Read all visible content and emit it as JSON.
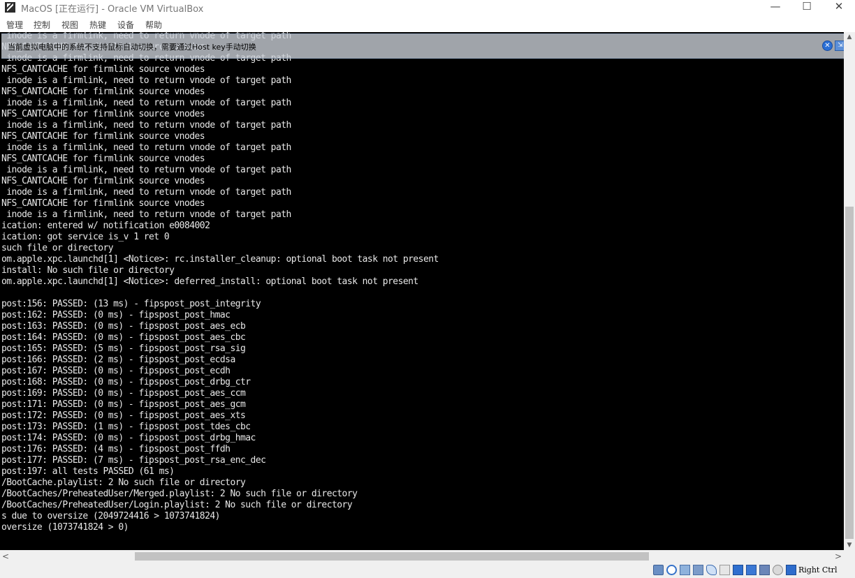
{
  "window": {
    "title": "MacOS [正在运行] - Oracle VM VirtualBox",
    "minimize_glyph": "—",
    "maximize_glyph": "☐",
    "close_glyph": "✕"
  },
  "menu": [
    "管理",
    "控制",
    "视图",
    "热键",
    "设备",
    "帮助"
  ],
  "notice": {
    "text": "当前虚拟电脑中的系统不支持鼠标自动切换，需要通过Host key手动切换",
    "close_glyph": "✕",
    "tool_glyph": "⇲"
  },
  "console": {
    "lines": [
      " inode is a firmlink, need to return vnode of target path",
      "NFS_CANTCACHE for firmlink source vnodes",
      " inode is a firmlink, need to return vnode of target path",
      "NFS_CANTCACHE for firmlink source vnodes",
      " inode is a firmlink, need to return vnode of target path",
      "NFS_CANTCACHE for firmlink source vnodes",
      " inode is a firmlink, need to return vnode of target path",
      "NFS_CANTCACHE for firmlink source vnodes",
      " inode is a firmlink, need to return vnode of target path",
      "NFS_CANTCACHE for firmlink source vnodes",
      " inode is a firmlink, need to return vnode of target path",
      "NFS_CANTCACHE for firmlink source vnodes",
      " inode is a firmlink, need to return vnode of target path",
      "NFS_CANTCACHE for firmlink source vnodes",
      " inode is a firmlink, need to return vnode of target path",
      "NFS_CANTCACHE for firmlink source vnodes",
      " inode is a firmlink, need to return vnode of target path",
      "ication: entered w/ notification e0084002",
      "ication: got service is_v 1 ret 0",
      "such file or directory",
      "om.apple.xpc.launchd[1] <Notice>: rc.installer_cleanup: optional boot task not present",
      "install: No such file or directory",
      "om.apple.xpc.launchd[1] <Notice>: deferred_install: optional boot task not present",
      "",
      "post:156: PASSED: (13 ms) - fipspost_post_integrity",
      "post:162: PASSED: (0 ms) - fipspost_post_hmac",
      "post:163: PASSED: (0 ms) - fipspost_post_aes_ecb",
      "post:164: PASSED: (0 ms) - fipspost_post_aes_cbc",
      "post:165: PASSED: (5 ms) - fipspost_post_rsa_sig",
      "post:166: PASSED: (2 ms) - fipspost_post_ecdsa",
      "post:167: PASSED: (0 ms) - fipspost_post_ecdh",
      "post:168: PASSED: (0 ms) - fipspost_post_drbg_ctr",
      "post:169: PASSED: (0 ms) - fipspost_post_aes_ccm",
      "post:171: PASSED: (0 ms) - fipspost_post_aes_gcm",
      "post:172: PASSED: (0 ms) - fipspost_post_aes_xts",
      "post:173: PASSED: (1 ms) - fipspost_post_tdes_cbc",
      "post:174: PASSED: (0 ms) - fipspost_post_drbg_hmac",
      "post:176: PASSED: (4 ms) - fipspost_post_ffdh",
      "post:177: PASSED: (7 ms) - fipspost_post_rsa_enc_dec",
      "post:197: all tests PASSED (61 ms)",
      "/BootCache.playlist: 2 No such file or directory",
      "/BootCaches/PreheatedUser/Merged.playlist: 2 No such file or directory",
      "/BootCaches/PreheatedUser/Login.playlist: 2 No such file or directory",
      "s due to oversize (2049724416 > 1073741824)",
      "oversize (1073741824 > 0)"
    ]
  },
  "scrollbars": {
    "up_glyph": "▲",
    "down_glyph": "▼",
    "left_glyph": "<",
    "right_glyph": ">"
  },
  "status": {
    "icons": [
      "hard-disk-icon",
      "optical-drive-icon",
      "audio-icon",
      "network-icon",
      "usb-icon",
      "shared-folder-icon",
      "display-icon",
      "video-capture-icon",
      "vt-x-icon",
      "mouse-integration-icon",
      "keyboard-capture-icon"
    ],
    "host_key": "Right Ctrl",
    "accent": "#2a6fd6"
  }
}
